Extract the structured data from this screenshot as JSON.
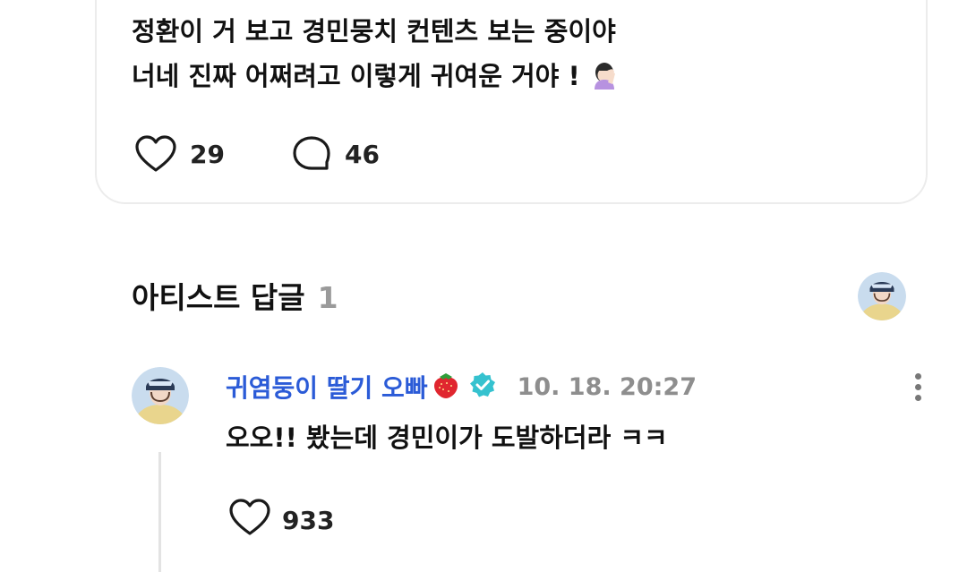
{
  "post": {
    "line1": "정환이 거 보고 경민뭉치 컨텐츠 보는 중이야",
    "line2": "너네 진짜 어쩌려고 이렇게 귀여운 거야 !",
    "like_count": "29",
    "comment_count": "46"
  },
  "artist_replies": {
    "title": "아티스트 답글",
    "count": "1"
  },
  "reply": {
    "author": "귀염둥이 딸기 오빠",
    "timestamp": "10. 18. 20:27",
    "text": "오오!! 봤는데 경민이가 도발하더라 ㅋㅋ",
    "like_count": "933"
  },
  "icons": {
    "like": "heart-outline-icon",
    "comment": "speech-bubble-icon",
    "verified": "verified-badge-icon",
    "more": "more-vertical-icon",
    "emoji": "facepalm-emoji",
    "author_emoji": "strawberry-emoji"
  },
  "colors": {
    "author_name": "#2b5bd7",
    "verified_badge": "#35c2cf",
    "timestamp": "#8e8e8e",
    "count_muted": "#9a9a9a"
  }
}
